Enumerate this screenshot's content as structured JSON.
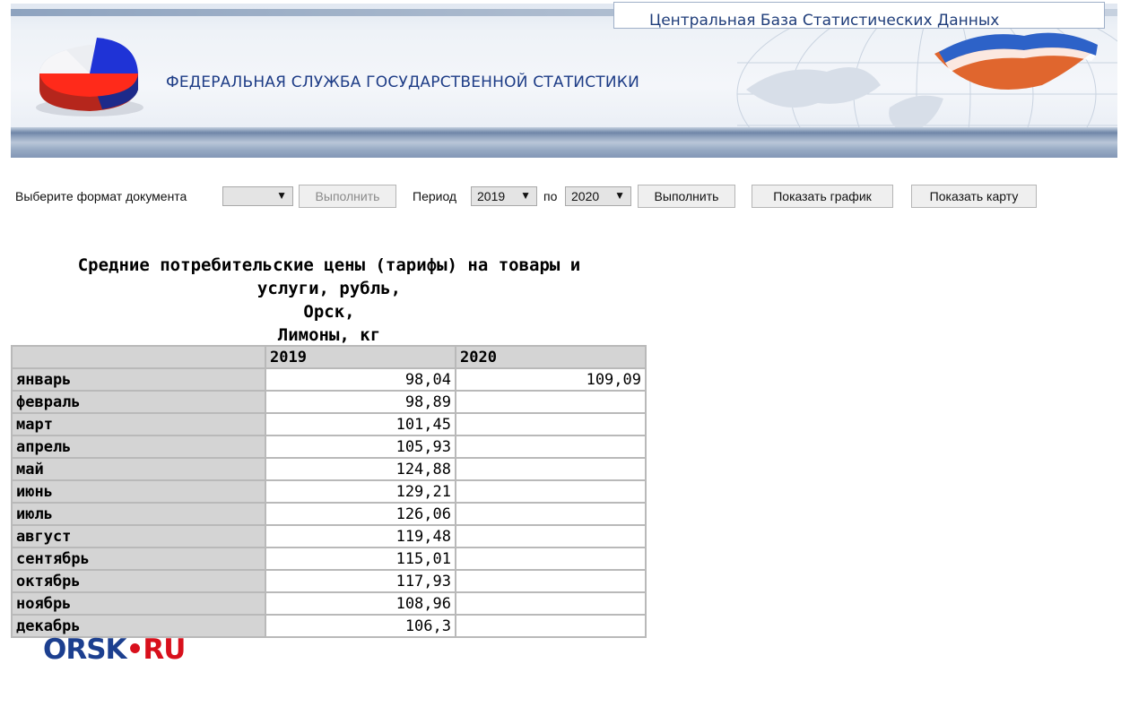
{
  "banner": {
    "db_title": "Центральная База Статистических Данных",
    "org_title": "ФЕДЕРАЛЬНАЯ СЛУЖБА ГОСУДАРСТВЕННОЙ СТАТИСТИКИ"
  },
  "toolbar": {
    "format_label": "Выберите формат документа",
    "format_value": "",
    "execute_disabled_label": "Выполнить",
    "period_label": "Период",
    "period_from": "2019",
    "period_to_label": "по",
    "period_to": "2020",
    "execute_label": "Выполнить",
    "show_chart_label": "Показать график",
    "show_map_label": "Показать карту"
  },
  "report": {
    "title_lines": [
      "Средние потребительские цены (тарифы) на товары и",
      "услуги, рубль,",
      "Орск,",
      "Лимоны, кг"
    ],
    "columns": [
      "",
      "2019",
      "2020"
    ],
    "rows": [
      {
        "month": "январь",
        "v2019": "98,04",
        "v2020": "109,09"
      },
      {
        "month": "февраль",
        "v2019": "98,89",
        "v2020": ""
      },
      {
        "month": "март",
        "v2019": "101,45",
        "v2020": ""
      },
      {
        "month": "апрель",
        "v2019": "105,93",
        "v2020": ""
      },
      {
        "month": "май",
        "v2019": "124,88",
        "v2020": ""
      },
      {
        "month": "июнь",
        "v2019": "129,21",
        "v2020": ""
      },
      {
        "month": "июль",
        "v2019": "126,06",
        "v2020": ""
      },
      {
        "month": "август",
        "v2019": "119,48",
        "v2020": ""
      },
      {
        "month": "сентябрь",
        "v2019": "115,01",
        "v2020": ""
      },
      {
        "month": "октябрь",
        "v2019": "117,93",
        "v2020": ""
      },
      {
        "month": "ноябрь",
        "v2019": "108,96",
        "v2020": ""
      },
      {
        "month": "декабрь",
        "v2019": "106,3",
        "v2020": ""
      }
    ]
  },
  "watermark": {
    "part1": "ORSK",
    "part2": "•RU"
  }
}
